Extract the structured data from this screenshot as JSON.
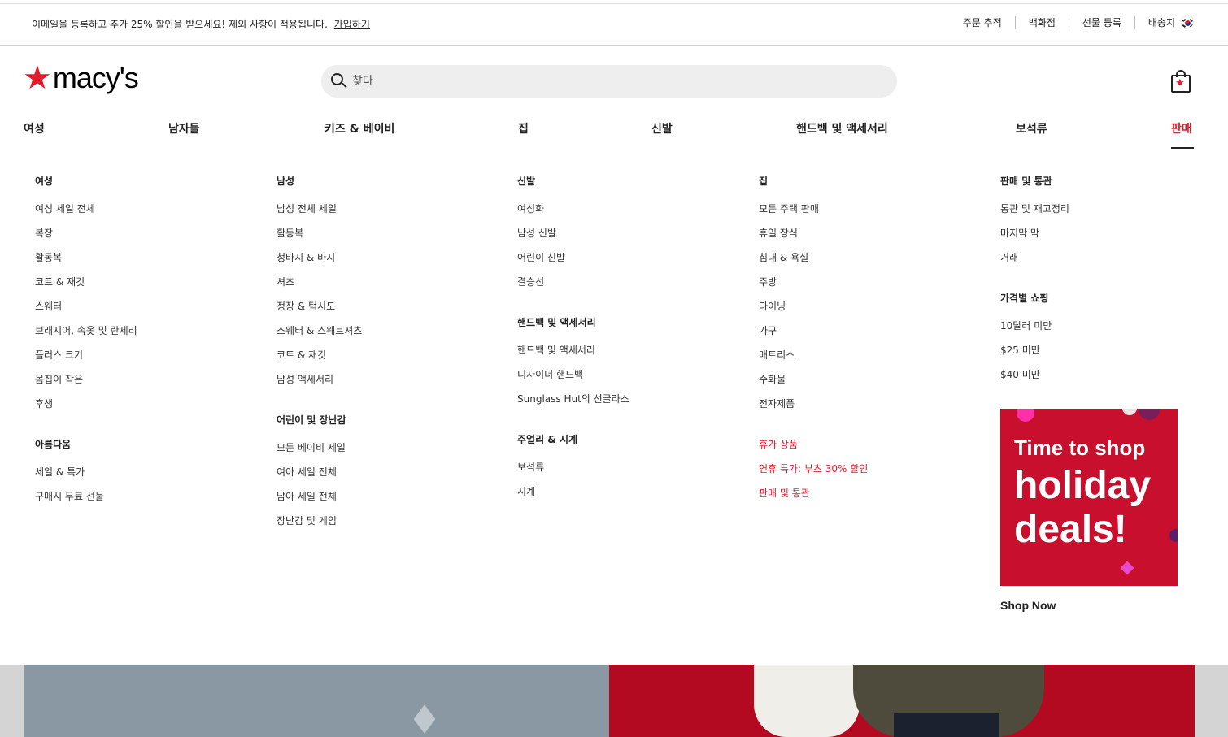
{
  "topbar": {
    "promo_text": "이메일을 등록하고 추가 25% 할인을 받으세요! 제외 사항이 적용됩니다.",
    "promo_link": "가입하기",
    "util": [
      "주문 추적",
      "백화점",
      "선물 등록",
      "배송지"
    ]
  },
  "header": {
    "logo_text": "macy's",
    "search_placeholder": "찾다"
  },
  "nav": [
    "여성",
    "남자들",
    "키즈 & 베이비",
    "집",
    "신발",
    "핸드백 및 액세서리",
    "보석류",
    "판매"
  ],
  "menu": {
    "col1": {
      "head1": "여성",
      "items1": [
        "여성 세일 전체",
        "복장",
        "활동복",
        "코트 & 재킷",
        "스웨터",
        "브래지어, 속옷 및 란제리",
        "플러스 크기",
        "몸집이 작은",
        "후생"
      ],
      "head2": "아름다움",
      "items2": [
        "세일 & 특가",
        "구매시 무료 선물"
      ]
    },
    "col2": {
      "head1": "남성",
      "items1": [
        "남성 전체 세일",
        "활동복",
        "청바지 & 바지",
        "셔츠",
        "정장 & 턱시도",
        "스웨터 & 스웨트셔츠",
        "코트 & 재킷",
        "남성 액세서리"
      ],
      "head2": "어린이 및 장난감",
      "items2": [
        "모든 베이비 세일",
        "여아 세일 전체",
        "남아 세일 전체",
        "장난감 및 게임"
      ]
    },
    "col3": {
      "head1": "신발",
      "items1": [
        "여성화",
        "남성 신발",
        "어린이 신발",
        "결승선"
      ],
      "head2": "핸드백 및 액세서리",
      "items2": [
        "핸드백 및 액세서리",
        "디자이너 핸드백",
        "Sunglass Hut의 선글라스"
      ],
      "head3": "주얼리 & 시계",
      "items3": [
        "보석류",
        "시계"
      ]
    },
    "col4": {
      "head1": "집",
      "items1": [
        "모든 주택 판매",
        "휴일 장식",
        "침대 & 욕실",
        "주방",
        "다이닝",
        "가구",
        "매트리스",
        "수화물",
        "전자제품"
      ],
      "items2": [
        "휴가 상품",
        "연휴 특가: 부츠 30% 할인",
        "판매 및 통관"
      ]
    },
    "col5": {
      "head1": "판매 및 통관",
      "items1": [
        "통관 및 재고정리",
        "마지막 막",
        "거래"
      ],
      "head2": "가격별 쇼핑",
      "items2": [
        "10달러 미만",
        "$25 미만",
        "$40 미만"
      ]
    }
  },
  "promo_card": {
    "line1": "Time to shop",
    "line2": "holiday",
    "line3": "deals!",
    "cta": "Shop Now"
  },
  "colors": {
    "brand_red": "#e21a2c",
    "card_red": "#c8102e"
  }
}
